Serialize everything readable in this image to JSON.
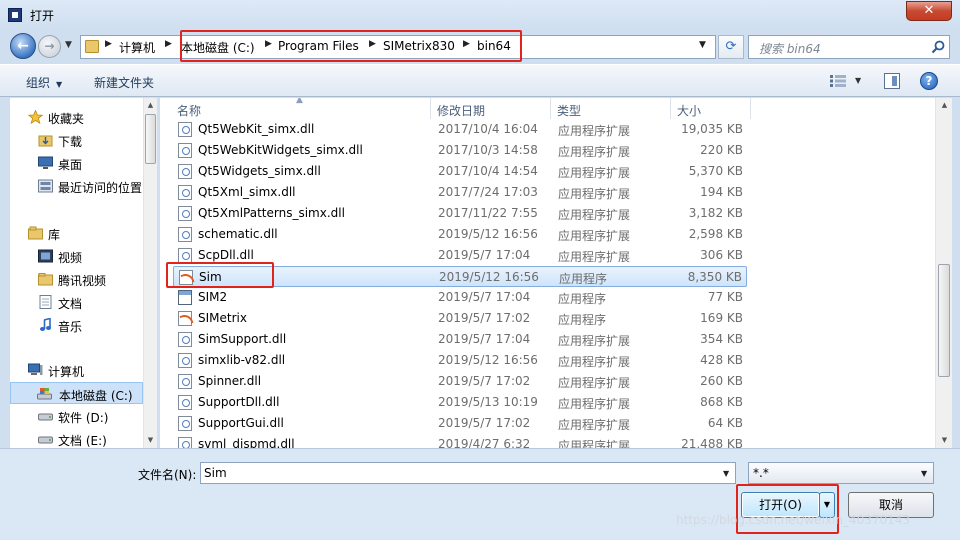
{
  "window": {
    "title": "打开",
    "close_label": "✕"
  },
  "nav": {
    "back_glyph": "←",
    "forward_glyph": "→",
    "breadcrumbs": [
      "计算机",
      "本地磁盘 (C:)",
      "Program Files",
      "SIMetrix830",
      "bin64"
    ],
    "refresh_glyph": "⟳",
    "search_placeholder": "搜索 bin64"
  },
  "toolbar": {
    "organize_label": "组织",
    "new_folder_label": "新建文件夹",
    "help_label": "?"
  },
  "sidebar": {
    "items": [
      {
        "label": "收藏夹",
        "icon": "star-icon"
      },
      {
        "label": "下载",
        "icon": "download-folder-icon"
      },
      {
        "label": "桌面",
        "icon": "desktop-icon"
      },
      {
        "label": "最近访问的位置",
        "icon": "recent-places-icon"
      },
      {
        "label": "库",
        "icon": "library-icon"
      },
      {
        "label": "视频",
        "icon": "video-icon"
      },
      {
        "label": "腾讯视频",
        "icon": "folder-icon"
      },
      {
        "label": "文档",
        "icon": "document-icon"
      },
      {
        "label": "音乐",
        "icon": "music-icon"
      },
      {
        "label": "计算机",
        "icon": "computer-icon"
      },
      {
        "label": "本地磁盘 (C:)",
        "icon": "drive-icon"
      },
      {
        "label": "软件 (D:)",
        "icon": "drive-icon"
      },
      {
        "label": "文档 (E:)",
        "icon": "drive-icon"
      }
    ]
  },
  "file_list": {
    "columns": {
      "name": "名称",
      "date": "修改日期",
      "type": "类型",
      "size": "大小"
    },
    "rows": [
      {
        "name": "Qt5WebKit_simx.dll",
        "date": "2017/10/4 16:04",
        "type": "应用程序扩展",
        "size": "19,035 KB",
        "kind": "dll"
      },
      {
        "name": "Qt5WebKitWidgets_simx.dll",
        "date": "2017/10/3 14:58",
        "type": "应用程序扩展",
        "size": "220 KB",
        "kind": "dll"
      },
      {
        "name": "Qt5Widgets_simx.dll",
        "date": "2017/10/4 14:54",
        "type": "应用程序扩展",
        "size": "5,370 KB",
        "kind": "dll"
      },
      {
        "name": "Qt5Xml_simx.dll",
        "date": "2017/7/24 17:03",
        "type": "应用程序扩展",
        "size": "194 KB",
        "kind": "dll"
      },
      {
        "name": "Qt5XmlPatterns_simx.dll",
        "date": "2017/11/22 7:55",
        "type": "应用程序扩展",
        "size": "3,182 KB",
        "kind": "dll"
      },
      {
        "name": "schematic.dll",
        "date": "2019/5/12 16:56",
        "type": "应用程序扩展",
        "size": "2,598 KB",
        "kind": "dll"
      },
      {
        "name": "ScpDll.dll",
        "date": "2019/5/7 17:04",
        "type": "应用程序扩展",
        "size": "306 KB",
        "kind": "dll"
      },
      {
        "name": "Sim",
        "date": "2019/5/12 16:56",
        "type": "应用程序",
        "size": "8,350 KB",
        "kind": "sim",
        "selected": true
      },
      {
        "name": "SIM2",
        "date": "2019/5/7 17:04",
        "type": "应用程序",
        "size": "77 KB",
        "kind": "exe"
      },
      {
        "name": "SIMetrix",
        "date": "2019/5/7 17:02",
        "type": "应用程序",
        "size": "169 KB",
        "kind": "sim"
      },
      {
        "name": "SimSupport.dll",
        "date": "2019/5/7 17:04",
        "type": "应用程序扩展",
        "size": "354 KB",
        "kind": "dll"
      },
      {
        "name": "simxlib-v82.dll",
        "date": "2019/5/12 16:56",
        "type": "应用程序扩展",
        "size": "428 KB",
        "kind": "dll"
      },
      {
        "name": "Spinner.dll",
        "date": "2019/5/7 17:02",
        "type": "应用程序扩展",
        "size": "260 KB",
        "kind": "dll"
      },
      {
        "name": "SupportDll.dll",
        "date": "2019/5/13 10:19",
        "type": "应用程序扩展",
        "size": "868 KB",
        "kind": "dll"
      },
      {
        "name": "SupportGui.dll",
        "date": "2019/5/7 17:02",
        "type": "应用程序扩展",
        "size": "64 KB",
        "kind": "dll"
      },
      {
        "name": "svml_dispmd.dll",
        "date": "2019/4/27 6:32",
        "type": "应用程序扩展",
        "size": "21,488 KB",
        "kind": "dll"
      }
    ]
  },
  "bottom": {
    "filename_label": "文件名(N):",
    "filename_value": "Sim",
    "filter_value": "*.*",
    "open_label": "打开(O)",
    "cancel_label": "取消"
  },
  "watermark": "https://blog.csdn.net/weixin_40370143",
  "colors": {
    "highlight": "#e0241b",
    "selection": "#cde4fb"
  }
}
